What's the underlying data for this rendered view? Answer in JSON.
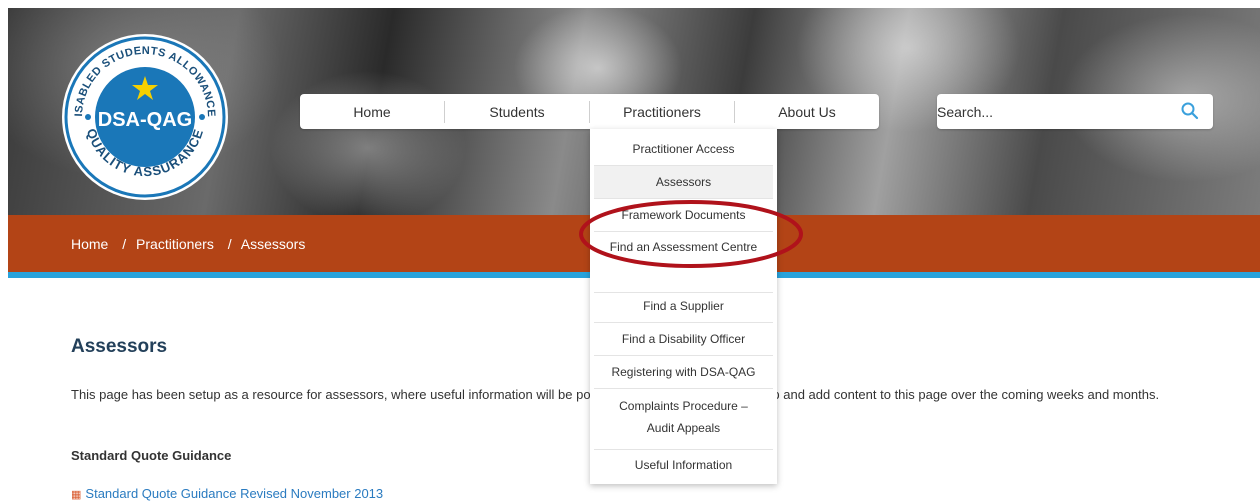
{
  "logo": {
    "arc_text_top": "DISABLED STUDENTS ALLOWANCES",
    "arc_text_bottom": "QUALITY ASSURANCE",
    "title": "DSA-QAG"
  },
  "nav": {
    "items": [
      {
        "label": "Home"
      },
      {
        "label": "Students"
      },
      {
        "label": "Practitioners"
      },
      {
        "label": "About Us"
      }
    ]
  },
  "search": {
    "placeholder": "Search...",
    "icon": "search-icon"
  },
  "breadcrumb": {
    "items": [
      "Home",
      "Practitioners",
      "Assessors"
    ],
    "separator": "/"
  },
  "dropdown": {
    "items": [
      {
        "label": "Practitioner Access"
      },
      {
        "label": "Assessors"
      },
      {
        "label": "Framework Documents"
      },
      {
        "label": "Find an Assessment Centre"
      },
      {
        "label": "Find a Supplier"
      },
      {
        "label": "Find a Disability Officer"
      },
      {
        "label": "Registering with DSA-QAG"
      },
      {
        "label": "Complaints Procedure – Audit Appeals"
      },
      {
        "label": "Useful Information"
      }
    ]
  },
  "main": {
    "title": "Assessors",
    "intro": "This page has been setup as a resource for assessors, where useful information will be posted. We will continue to develop and add content to this page over the coming weeks and months.",
    "section_heading": "Standard Quote Guidance",
    "document_link": "Standard Quote Guidance Revised November 2013"
  },
  "colors": {
    "brand_orange": "#b34416",
    "brand_blue": "#29a3dc",
    "highlight_red": "#b0121b",
    "title_navy": "#23405a"
  }
}
